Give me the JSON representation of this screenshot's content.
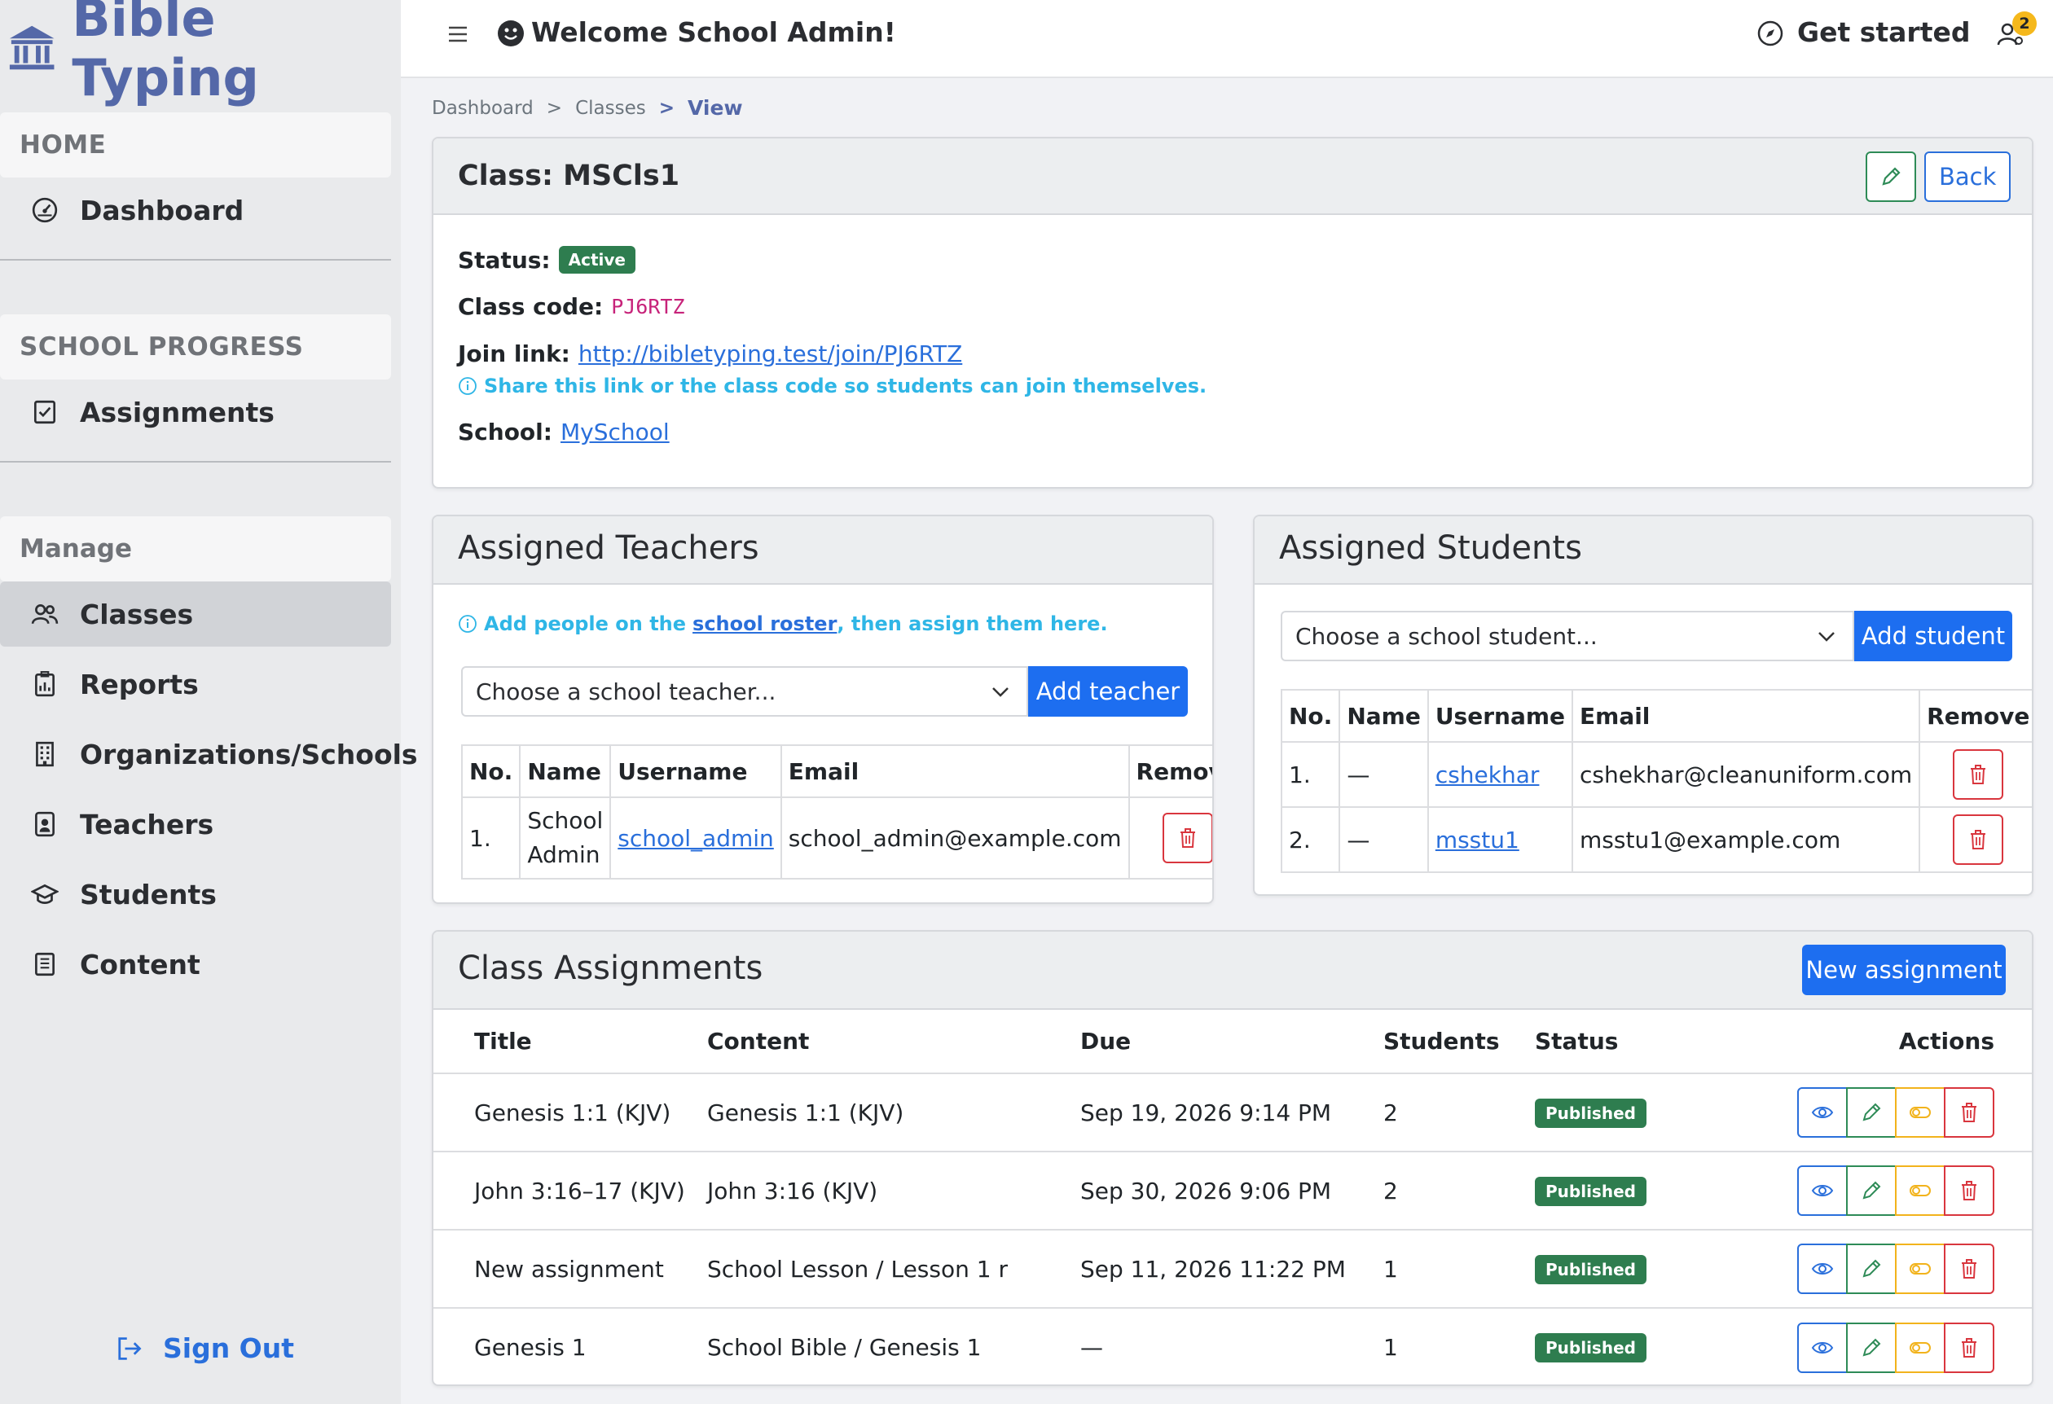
{
  "sidebar": {
    "brand": "Bible Typing",
    "home_heading": "HOME",
    "dashboard": "Dashboard",
    "progress_heading": "SCHOOL PROGRESS",
    "assignments": "Assignments",
    "manage_heading": "Manage",
    "items": [
      "Classes",
      "Reports",
      "Organizations/Schools",
      "Teachers",
      "Students",
      "Content"
    ],
    "sign_out": "Sign Out"
  },
  "topbar": {
    "welcome": "Welcome School Admin!",
    "get_started": "Get started",
    "notifications": "2"
  },
  "breadcrumb": {
    "dashboard": "Dashboard",
    "sep1": ">",
    "classes": "Classes",
    "sep2": ">",
    "current": "View"
  },
  "class": {
    "title": "Class: MSCls1",
    "back": "Back",
    "status_label": "Status:",
    "status": "Active",
    "code_label": "Class code:",
    "code": "PJ6RTZ",
    "join_label": "Join link:",
    "join_link": "http://bibletyping.test/join/PJ6RTZ",
    "join_hint": "Share this link or the class code so students can join themselves.",
    "school_label": "School:",
    "school": "MySchool"
  },
  "teachers": {
    "title": "Assigned Teachers",
    "hint_pre": "Add people on the",
    "hint_link": "school roster",
    "hint_post": ", then assign them here.",
    "select_placeholder": "Choose a school teacher...",
    "add": "Add teacher",
    "columns": [
      "No.",
      "Name",
      "Username",
      "Email",
      "Remove"
    ],
    "rows": [
      {
        "no": "1.",
        "name_line1": "School",
        "name_line2": "Admin",
        "username": "school_admin",
        "email": "school_admin@example.com"
      }
    ]
  },
  "students": {
    "title": "Assigned Students",
    "select_placeholder": "Choose a school student...",
    "add": "Add student",
    "columns": [
      "No.",
      "Name",
      "Username",
      "Email",
      "Remove"
    ],
    "rows": [
      {
        "no": "1.",
        "name": "—",
        "username": "cshekhar",
        "email": "cshekhar@cleanuniform.com"
      },
      {
        "no": "2.",
        "name": "—",
        "username": "msstu1",
        "email": "msstu1@example.com"
      }
    ]
  },
  "assignments": {
    "title": "Class Assignments",
    "new": "New assignment",
    "columns": [
      "Title",
      "Content",
      "Due",
      "Students",
      "Status",
      "Actions"
    ],
    "rows": [
      {
        "title": "Genesis 1:1 (KJV)",
        "content": "Genesis 1:1 (KJV)",
        "due": "Sep 19, 2026 9:14 PM",
        "students": "2",
        "status": "Published"
      },
      {
        "title": "John 3:16–17 (KJV)",
        "content": "John 3:16 (KJV)",
        "due": "Sep 30, 2026 9:06 PM",
        "students": "2",
        "status": "Published"
      },
      {
        "title": "New assignment",
        "content": "School Lesson / Lesson 1 r",
        "due": "Sep 11, 2026 11:22 PM",
        "students": "1",
        "status": "Published"
      },
      {
        "title": "Genesis 1",
        "content": "School Bible / Genesis 1",
        "due": "—",
        "students": "1",
        "status": "Published"
      }
    ]
  },
  "colors": {
    "brand": "#5468a8",
    "primary": "#1d6ef0",
    "success": "#2e7d4f",
    "danger": "#d9363e",
    "warning": "#f2b31c",
    "info": "#2fb6e6"
  }
}
